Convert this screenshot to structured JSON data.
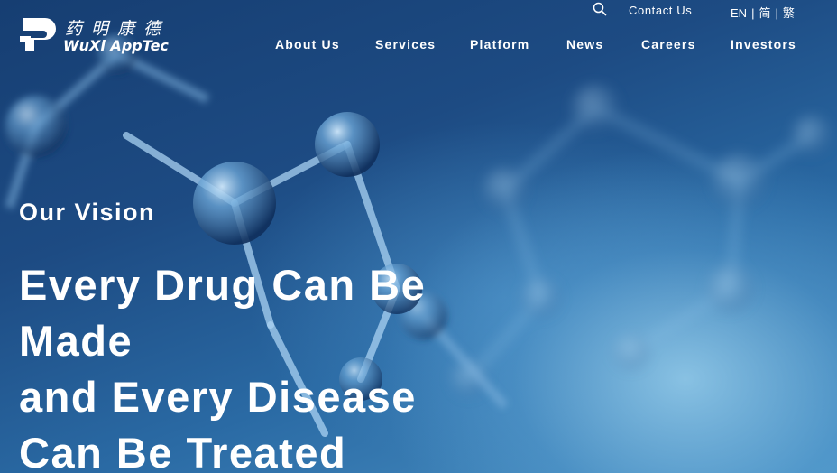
{
  "brand": {
    "name_cn": "药明康德",
    "name_en": "WuXi AppTec",
    "accent": "#ffffff",
    "background": "#1d4b83"
  },
  "topbar": {
    "search_icon": "search-icon",
    "contact_label": "Contact Us",
    "languages": [
      "EN",
      "简",
      "繁"
    ],
    "separator": "|"
  },
  "nav": {
    "items": [
      {
        "label": "About Us"
      },
      {
        "label": "Services"
      },
      {
        "label": "Platform"
      },
      {
        "label": "News"
      },
      {
        "label": "Careers"
      },
      {
        "label": "Investors"
      }
    ]
  },
  "hero": {
    "eyebrow": "Our Vision",
    "headline_lines": [
      "Every Drug Can Be",
      "Made",
      "and Every Disease",
      "Can Be Treated"
    ]
  }
}
